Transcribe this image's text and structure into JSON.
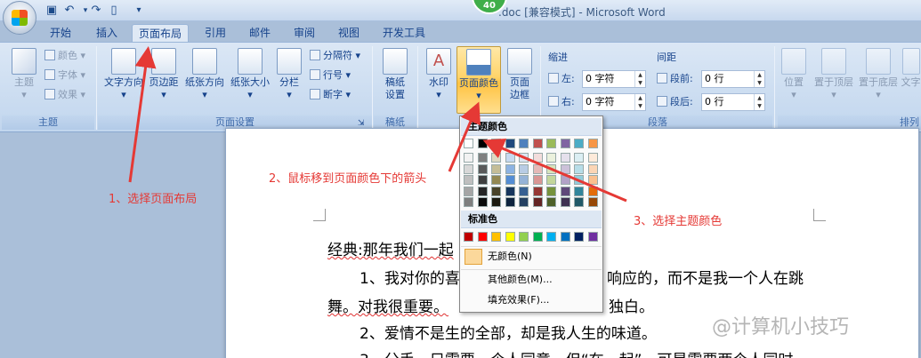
{
  "window": {
    "title_prefix": "",
    "title": ".doc [兼容模式] - Microsoft Word",
    "badge": "40"
  },
  "qat": {
    "icons": [
      "save-icon",
      "undo-icon",
      "redo-icon",
      "new-doc-icon",
      "customize-icon"
    ]
  },
  "tabs": [
    {
      "label": "开始"
    },
    {
      "label": "插入"
    },
    {
      "label": "页面布局"
    },
    {
      "label": "引用"
    },
    {
      "label": "邮件"
    },
    {
      "label": "审阅"
    },
    {
      "label": "视图"
    },
    {
      "label": "开发工具"
    }
  ],
  "ribbon": {
    "theme": {
      "big": "主题",
      "colors": "颜色",
      "fonts": "字体",
      "effects": "效果",
      "group": "主题"
    },
    "page_setup": {
      "direction": "文字方向",
      "margins": "页边距",
      "orientation": "纸张方向",
      "size": "纸张大小",
      "columns": "分栏",
      "breaks": "分隔符",
      "line_numbers": "行号",
      "hyphenation": "断字",
      "group": "页面设置"
    },
    "draft": {
      "label1": "稿纸",
      "label2": "设置",
      "group": "稿纸"
    },
    "background": {
      "watermark": "水印",
      "page_color": "页面颜色",
      "page_border1": "页面",
      "page_border2": "边框"
    },
    "paragraph": {
      "indent": "缩进",
      "left": "左:",
      "right": "右:",
      "left_val": "0 字符",
      "right_val": "0 字符",
      "spacing": "间距",
      "before": "段前:",
      "after": "段后:",
      "before_val": "0 行",
      "after_val": "0 行",
      "group": "段落"
    },
    "arrange": {
      "position": "位置",
      "front": "置于顶层",
      "back": "置于底层",
      "wrap": "文字",
      "group": "排列"
    }
  },
  "dropdown": {
    "theme_colors": "主题颜色",
    "standard_colors": "标准色",
    "no_color": "无颜色(N)",
    "more_colors": "其他颜色(M)...",
    "fill_effects": "填充效果(F)...",
    "theme_top": [
      "#ffffff",
      "#000000",
      "#eeece1",
      "#1f497d",
      "#4f81bd",
      "#c0504d",
      "#9bbb59",
      "#8064a2",
      "#4bacc6",
      "#f79646"
    ],
    "theme_shades": [
      [
        "#f2f2f2",
        "#7f7f7f",
        "#ddd9c3",
        "#c6d9f0",
        "#dbe5f1",
        "#f2dcdb",
        "#ebf1dd",
        "#e5e0ec",
        "#dbeef3",
        "#fdeada"
      ],
      [
        "#d8d8d8",
        "#595959",
        "#c4bd97",
        "#8db3e2",
        "#b8cce4",
        "#e5b9b7",
        "#d7e3bc",
        "#ccc1d9",
        "#b7dde8",
        "#fbd5b5"
      ],
      [
        "#bfbfbf",
        "#3f3f3f",
        "#938953",
        "#548dd4",
        "#95b3d7",
        "#d99694",
        "#c3d69b",
        "#b2a2c7",
        "#92cddc",
        "#fac08f"
      ],
      [
        "#a5a5a5",
        "#262626",
        "#494429",
        "#17365d",
        "#366092",
        "#953734",
        "#76923c",
        "#5f497a",
        "#31859b",
        "#e36c09"
      ],
      [
        "#7f7f7f",
        "#0c0c0c",
        "#1d1b10",
        "#0f243e",
        "#244061",
        "#632423",
        "#4f6128",
        "#3f3151",
        "#205867",
        "#974806"
      ]
    ],
    "standard": [
      "#c00000",
      "#ff0000",
      "#ffc000",
      "#ffff00",
      "#92d050",
      "#00b050",
      "#00b0f0",
      "#0070c0",
      "#002060",
      "#7030a0"
    ]
  },
  "document": {
    "title_line": "经典:那年我们一起",
    "line1": "1、我对你的喜",
    "line1b": "响应的，而不是我一个人在跳",
    "line2a": "舞。对我很重要。",
    "line2b": "独白。",
    "line3": "2、爱情不是生的全部，却是我人生的味道。",
    "line4": "3、分手，只需要一个人同意，但“在一起”，可是需要两个人同时"
  },
  "annotations": {
    "step1": "1、选择页面布局",
    "step2": "2、鼠标移到页面颜色下的箭头",
    "step3": "3、选择主题颜色"
  },
  "watermark": "@计算机小技巧"
}
